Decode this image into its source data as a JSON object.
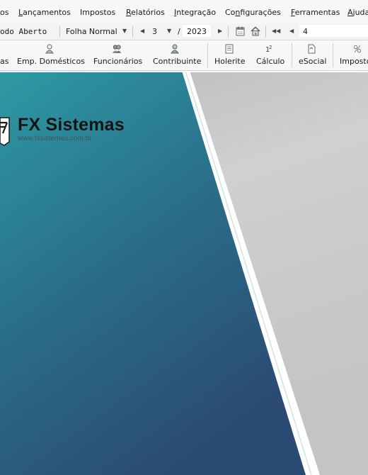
{
  "menu": {
    "items": [
      {
        "text": "os"
      },
      {
        "pre": "",
        "u": "L",
        "post": "ançamentos"
      },
      {
        "text": "Impostos"
      },
      {
        "pre": "",
        "u": "R",
        "post": "elatórios"
      },
      {
        "pre": "",
        "u": "I",
        "post": "ntegração"
      },
      {
        "pre": "Co",
        "u": "n",
        "post": "figurações"
      },
      {
        "pre": "",
        "u": "F",
        "post": "erramentas"
      },
      {
        "pre": "",
        "u": "A",
        "post": "juda"
      }
    ]
  },
  "period": {
    "status": "odo Aberto",
    "payroll_type": "Folha Normal",
    "month": "3",
    "slash": "/",
    "year": "2023",
    "number": "4"
  },
  "modules": {
    "cut_label": "as",
    "items": [
      {
        "label": "Emp. Domésticos",
        "icon": "domestic-employee-icon"
      },
      {
        "label": "Funcionários",
        "icon": "employees-icon"
      },
      {
        "label": "Contribuinte",
        "icon": "contributor-icon"
      },
      {
        "label": "Holerite",
        "icon": "payslip-icon"
      },
      {
        "label": "Cálculo",
        "icon": "calculation-icon"
      },
      {
        "label": "eSocial",
        "icon": "esocial-icon"
      },
      {
        "label": "Impostos",
        "icon": "taxes-icon"
      }
    ]
  },
  "splash": {
    "brand_name": "FX Sistemas",
    "brand_url": "www.fxsistemas.com.br",
    "colors": {
      "teal": "#2d9aa3",
      "navy": "#2b4a73",
      "gray": "#c7c7c7",
      "white": "#ffffff"
    }
  }
}
